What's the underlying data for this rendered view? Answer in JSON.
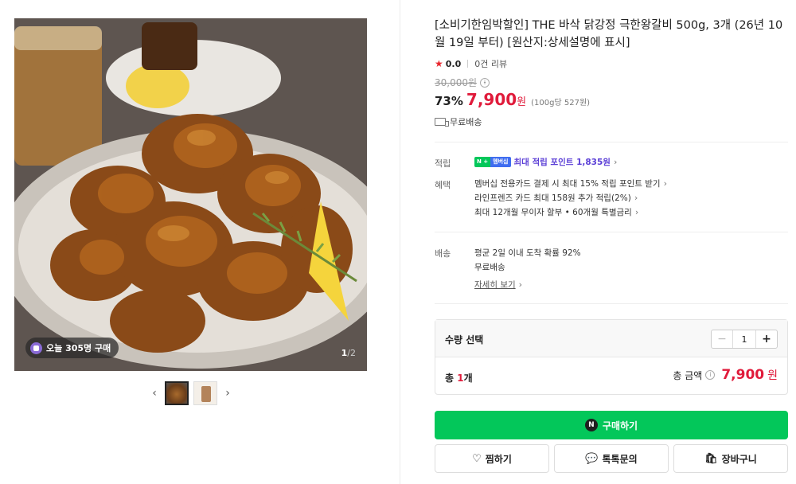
{
  "gallery": {
    "today_badge": "오늘 305명 구매",
    "counter_current": "1",
    "counter_total": "/2",
    "prev_icon": "chevron-left-icon",
    "next_icon": "chevron-right-icon"
  },
  "product": {
    "title": "[소비기한임박할인] THE 바삭 닭강정 극한왕갈비 500g, 3개 (26년 10월 19일 부터) [원산지:상세설명에 표시]",
    "rating_score": "0.0",
    "review_count": "0건 리뷰",
    "original_price": "30,000원",
    "discount": "73%",
    "price": "7,900",
    "price_unit": "원",
    "unit_price": "(100g당 527원)",
    "shipping_short": "무료배송"
  },
  "benefits": {
    "points_label": "적립",
    "points_badge_n": "N +",
    "points_badge_m": "멤버십",
    "points_text": "최대 적립 포인트 1,835원",
    "benefit_label": "혜택",
    "benefit_lines": [
      "멤버십 전용카드 결제 시 최대 15% 적립 포인트 받기",
      "라인프렌즈 카드 최대 158원 추가 적립(2%)",
      "최대 12개월 무이자 할부 • 60개월 특별금리"
    ],
    "delivery_label": "배송",
    "delivery_lines": [
      "평균 2일 이내 도착 확률 92%",
      "무료배송"
    ],
    "delivery_detail": "자세히 보기"
  },
  "quantity": {
    "title": "수량 선택",
    "minus": "−",
    "value": "1",
    "plus": "+",
    "total_prefix": "총 ",
    "total_count": "1",
    "total_suffix": "개",
    "total_label": "총 금액",
    "total_amount": "7,900",
    "total_unit": "원"
  },
  "actions": {
    "buy": "구매하기",
    "buy_badge": "N",
    "wish": "찜하기",
    "talk": "톡톡문의",
    "cart": "장바구니"
  },
  "colors": {
    "accent_red": "#e01b3b",
    "naver_green": "#03c75a",
    "point_purple": "#5b3fd6"
  }
}
